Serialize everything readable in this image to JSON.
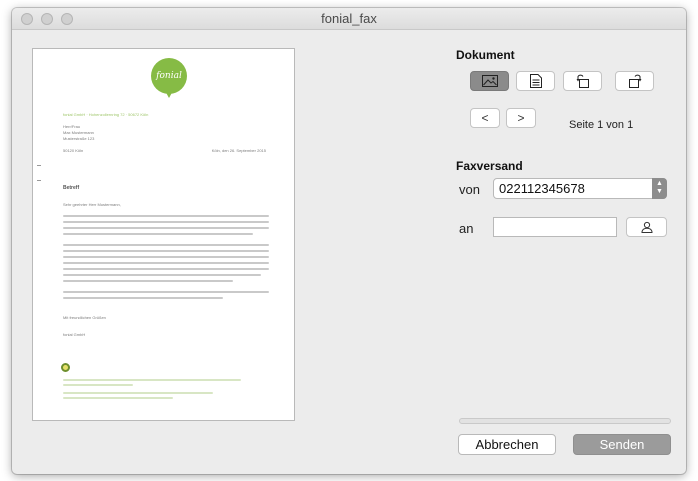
{
  "window": {
    "title": "fonial_fax"
  },
  "document_panel": {
    "heading": "Dokument",
    "tools": [
      {
        "name": "image-view",
        "icon": "image-icon",
        "active": true
      },
      {
        "name": "text-view",
        "icon": "document-icon",
        "active": false
      },
      {
        "name": "rotate-left",
        "icon": "rotate-left-icon",
        "active": false
      },
      {
        "name": "rotate-right",
        "icon": "rotate-right-icon",
        "active": false
      }
    ],
    "prev_label": "<",
    "next_label": ">",
    "page_info": "Seite 1 von 1"
  },
  "fax_panel": {
    "heading": "Faxversand",
    "from_label": "von",
    "from_value": "022112345678",
    "to_label": "an",
    "to_value": "",
    "contact_icon": "person-icon"
  },
  "progress": {
    "value": 0
  },
  "actions": {
    "cancel_label": "Abbrechen",
    "send_label": "Senden"
  },
  "preview": {
    "logo_text": "fonial",
    "sender_line": "fonial GmbH · Hohenzollernring 72 · 50672 Köln",
    "recipient": [
      "Herr/Frau",
      "Max Mustermann",
      "Musterstraße 123"
    ],
    "city_zip": "50120 Köln",
    "date": "Köln, den 26. September 2015",
    "subject": "Betreff",
    "salutation": "Sehr geehrter Herr Mustermann,",
    "closing": "Mit freundlichen Grüßen",
    "signature": "fonial GmbH"
  },
  "colors": {
    "accent_green": "#86bb45",
    "send_button": "#9b9b9b",
    "active_tool": "#8b8b8b"
  }
}
